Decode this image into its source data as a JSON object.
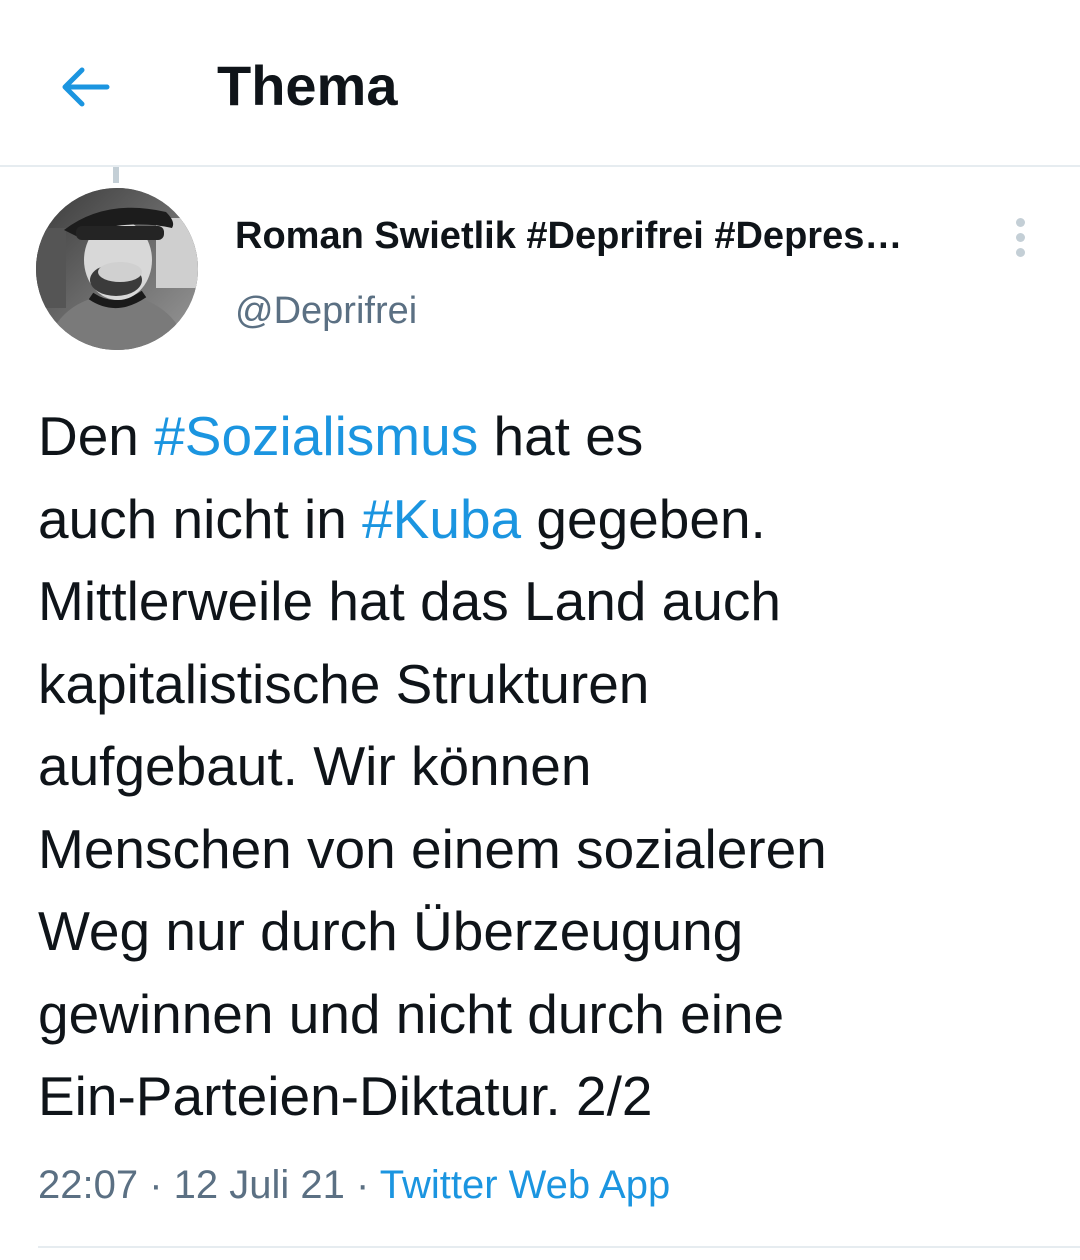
{
  "header": {
    "back_icon": "arrow-left-icon",
    "title": "Thema"
  },
  "tweet": {
    "author_name": "Roman Swietlik #Deprifrei #Depres…",
    "author_handle": "@Deprifrei",
    "more_icon": "more-vertical-icon",
    "lines": [
      {
        "before": "Den ",
        "hashtag": "#Sozialismus",
        "after": " hat es"
      },
      {
        "before": "auch nicht in ",
        "hashtag": "#Kuba",
        "after": " gegeben."
      },
      {
        "text": "Mittlerweile hat das Land auch"
      },
      {
        "text": "kapitalistische Strukturen"
      },
      {
        "text": "aufgebaut. Wir können"
      },
      {
        "text": "Menschen von einem sozialeren"
      },
      {
        "text": "Weg nur durch Überzeugung"
      },
      {
        "text": "gewinnen und nicht durch eine"
      },
      {
        "text": "Ein-Parteien-Diktatur. 2/2"
      }
    ],
    "time": "22:07",
    "separator": " · ",
    "date": "12 Juli 21",
    "source": "Twitter Web App"
  },
  "colors": {
    "link": "#1b95e0",
    "secondary_text": "#5b7083",
    "divider": "#e6ecf0"
  }
}
